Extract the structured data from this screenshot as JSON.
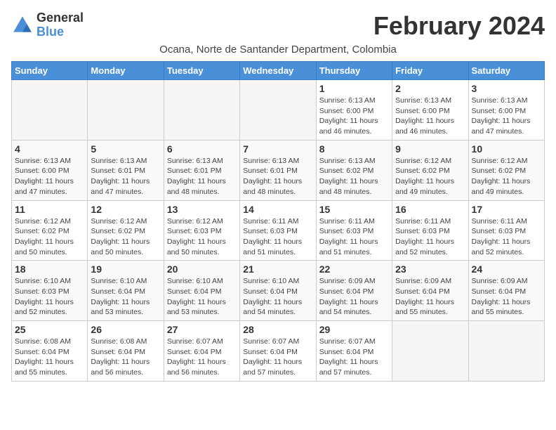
{
  "logo": {
    "general": "General",
    "blue": "Blue"
  },
  "title": "February 2024",
  "location": "Ocana, Norte de Santander Department, Colombia",
  "weekdays": [
    "Sunday",
    "Monday",
    "Tuesday",
    "Wednesday",
    "Thursday",
    "Friday",
    "Saturday"
  ],
  "weeks": [
    [
      {
        "day": "",
        "info": ""
      },
      {
        "day": "",
        "info": ""
      },
      {
        "day": "",
        "info": ""
      },
      {
        "day": "",
        "info": ""
      },
      {
        "day": "1",
        "info": "Sunrise: 6:13 AM\nSunset: 6:00 PM\nDaylight: 11 hours\nand 46 minutes."
      },
      {
        "day": "2",
        "info": "Sunrise: 6:13 AM\nSunset: 6:00 PM\nDaylight: 11 hours\nand 46 minutes."
      },
      {
        "day": "3",
        "info": "Sunrise: 6:13 AM\nSunset: 6:00 PM\nDaylight: 11 hours\nand 47 minutes."
      }
    ],
    [
      {
        "day": "4",
        "info": "Sunrise: 6:13 AM\nSunset: 6:00 PM\nDaylight: 11 hours\nand 47 minutes."
      },
      {
        "day": "5",
        "info": "Sunrise: 6:13 AM\nSunset: 6:01 PM\nDaylight: 11 hours\nand 47 minutes."
      },
      {
        "day": "6",
        "info": "Sunrise: 6:13 AM\nSunset: 6:01 PM\nDaylight: 11 hours\nand 48 minutes."
      },
      {
        "day": "7",
        "info": "Sunrise: 6:13 AM\nSunset: 6:01 PM\nDaylight: 11 hours\nand 48 minutes."
      },
      {
        "day": "8",
        "info": "Sunrise: 6:13 AM\nSunset: 6:02 PM\nDaylight: 11 hours\nand 48 minutes."
      },
      {
        "day": "9",
        "info": "Sunrise: 6:12 AM\nSunset: 6:02 PM\nDaylight: 11 hours\nand 49 minutes."
      },
      {
        "day": "10",
        "info": "Sunrise: 6:12 AM\nSunset: 6:02 PM\nDaylight: 11 hours\nand 49 minutes."
      }
    ],
    [
      {
        "day": "11",
        "info": "Sunrise: 6:12 AM\nSunset: 6:02 PM\nDaylight: 11 hours\nand 50 minutes."
      },
      {
        "day": "12",
        "info": "Sunrise: 6:12 AM\nSunset: 6:02 PM\nDaylight: 11 hours\nand 50 minutes."
      },
      {
        "day": "13",
        "info": "Sunrise: 6:12 AM\nSunset: 6:03 PM\nDaylight: 11 hours\nand 50 minutes."
      },
      {
        "day": "14",
        "info": "Sunrise: 6:11 AM\nSunset: 6:03 PM\nDaylight: 11 hours\nand 51 minutes."
      },
      {
        "day": "15",
        "info": "Sunrise: 6:11 AM\nSunset: 6:03 PM\nDaylight: 11 hours\nand 51 minutes."
      },
      {
        "day": "16",
        "info": "Sunrise: 6:11 AM\nSunset: 6:03 PM\nDaylight: 11 hours\nand 52 minutes."
      },
      {
        "day": "17",
        "info": "Sunrise: 6:11 AM\nSunset: 6:03 PM\nDaylight: 11 hours\nand 52 minutes."
      }
    ],
    [
      {
        "day": "18",
        "info": "Sunrise: 6:10 AM\nSunset: 6:03 PM\nDaylight: 11 hours\nand 52 minutes."
      },
      {
        "day": "19",
        "info": "Sunrise: 6:10 AM\nSunset: 6:04 PM\nDaylight: 11 hours\nand 53 minutes."
      },
      {
        "day": "20",
        "info": "Sunrise: 6:10 AM\nSunset: 6:04 PM\nDaylight: 11 hours\nand 53 minutes."
      },
      {
        "day": "21",
        "info": "Sunrise: 6:10 AM\nSunset: 6:04 PM\nDaylight: 11 hours\nand 54 minutes."
      },
      {
        "day": "22",
        "info": "Sunrise: 6:09 AM\nSunset: 6:04 PM\nDaylight: 11 hours\nand 54 minutes."
      },
      {
        "day": "23",
        "info": "Sunrise: 6:09 AM\nSunset: 6:04 PM\nDaylight: 11 hours\nand 55 minutes."
      },
      {
        "day": "24",
        "info": "Sunrise: 6:09 AM\nSunset: 6:04 PM\nDaylight: 11 hours\nand 55 minutes."
      }
    ],
    [
      {
        "day": "25",
        "info": "Sunrise: 6:08 AM\nSunset: 6:04 PM\nDaylight: 11 hours\nand 55 minutes."
      },
      {
        "day": "26",
        "info": "Sunrise: 6:08 AM\nSunset: 6:04 PM\nDaylight: 11 hours\nand 56 minutes."
      },
      {
        "day": "27",
        "info": "Sunrise: 6:07 AM\nSunset: 6:04 PM\nDaylight: 11 hours\nand 56 minutes."
      },
      {
        "day": "28",
        "info": "Sunrise: 6:07 AM\nSunset: 6:04 PM\nDaylight: 11 hours\nand 57 minutes."
      },
      {
        "day": "29",
        "info": "Sunrise: 6:07 AM\nSunset: 6:04 PM\nDaylight: 11 hours\nand 57 minutes."
      },
      {
        "day": "",
        "info": ""
      },
      {
        "day": "",
        "info": ""
      }
    ]
  ]
}
